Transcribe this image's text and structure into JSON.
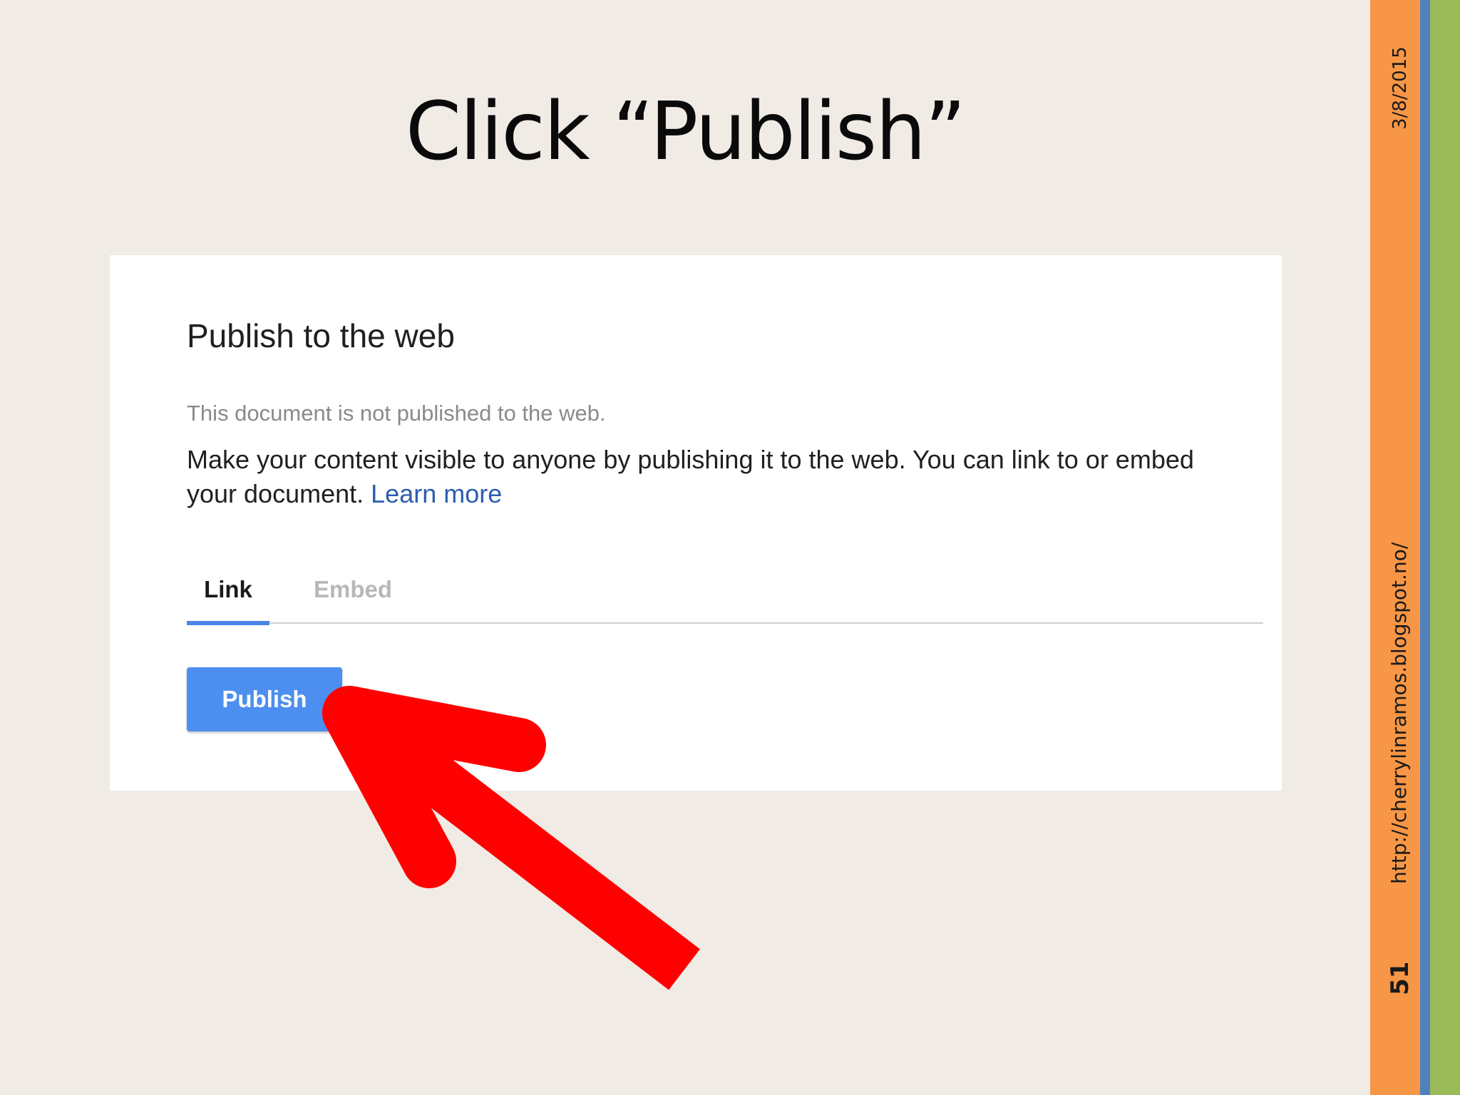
{
  "slide": {
    "title": "Click “Publish”",
    "date": "3/8/2015",
    "url": "http://cherrylinramos.blogspot.no/",
    "number": "51"
  },
  "colors": {
    "background": "#f0ebe5",
    "bar_orange": "#f79646",
    "bar_blue": "#4f81bd",
    "bar_green": "#9bbb59",
    "arrow": "#ff0000",
    "accent_blue": "#4d8ff0"
  },
  "dialog": {
    "title": "Publish to the web",
    "status": "This document is not published to the web.",
    "description": "Make your content visible to anyone by publishing it to the web. You can link to or embed your document.",
    "learn_more": "Learn more",
    "tabs": [
      {
        "label": "Link",
        "active": true
      },
      {
        "label": "Embed",
        "active": false
      }
    ],
    "publish_label": "Publish"
  },
  "annotation": {
    "icon": "arrow-pointer-icon"
  }
}
